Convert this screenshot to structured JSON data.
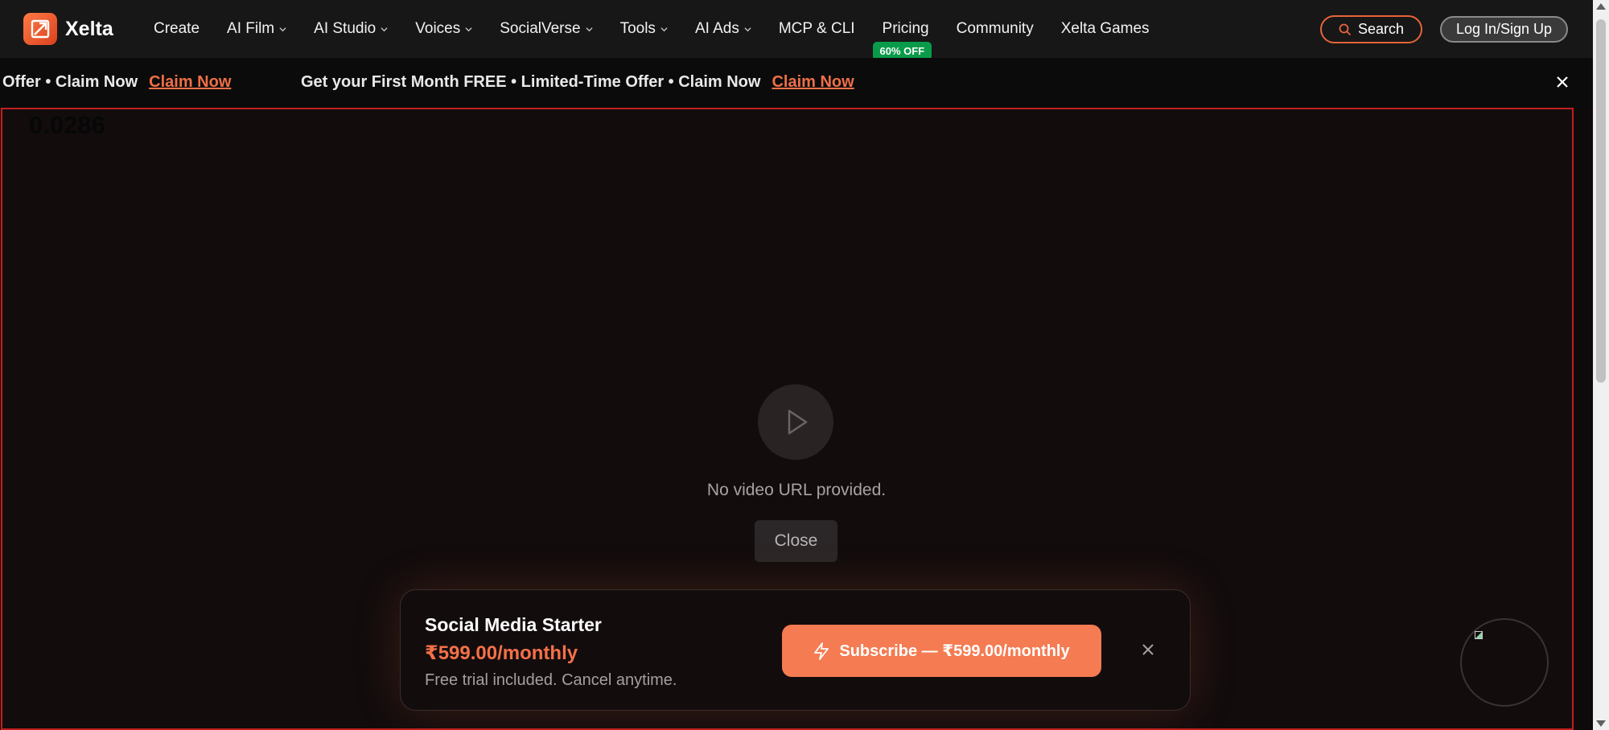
{
  "brand": {
    "name": "Xelta",
    "accent": "#e8643a"
  },
  "nav": {
    "items": [
      {
        "label": "Create",
        "dropdown": false
      },
      {
        "label": "AI Film",
        "dropdown": true
      },
      {
        "label": "AI Studio",
        "dropdown": true
      },
      {
        "label": "Voices",
        "dropdown": true
      },
      {
        "label": "SocialVerse",
        "dropdown": true
      },
      {
        "label": "Tools",
        "dropdown": true
      },
      {
        "label": "AI Ads",
        "dropdown": true
      },
      {
        "label": "MCP & CLI",
        "dropdown": false
      },
      {
        "label": "Pricing",
        "dropdown": false
      },
      {
        "label": "Community",
        "dropdown": false
      },
      {
        "label": "Xelta Games",
        "dropdown": false
      }
    ],
    "pricing_badge": "60% OFF",
    "pricing_badge_color": "#0a9b4a",
    "search_label": "Search",
    "login_label": "Log In/Sign Up"
  },
  "promo": {
    "text_partial": "Offer • Claim Now",
    "claim_label": "Claim Now",
    "text_full": "Get your First Month FREE • Limited-Time Offer • Claim Now",
    "claim_label_2": "Claim Now"
  },
  "player": {
    "counter": "0.0286",
    "message": "No video URL provided.",
    "close_label": "Close"
  },
  "subscription": {
    "title": "Social Media Starter",
    "price": "₹599.00/monthly",
    "note": "Free trial included. Cancel anytime.",
    "button_label": "Subscribe — ₹599.00/monthly",
    "button_color": "#f47b52"
  }
}
